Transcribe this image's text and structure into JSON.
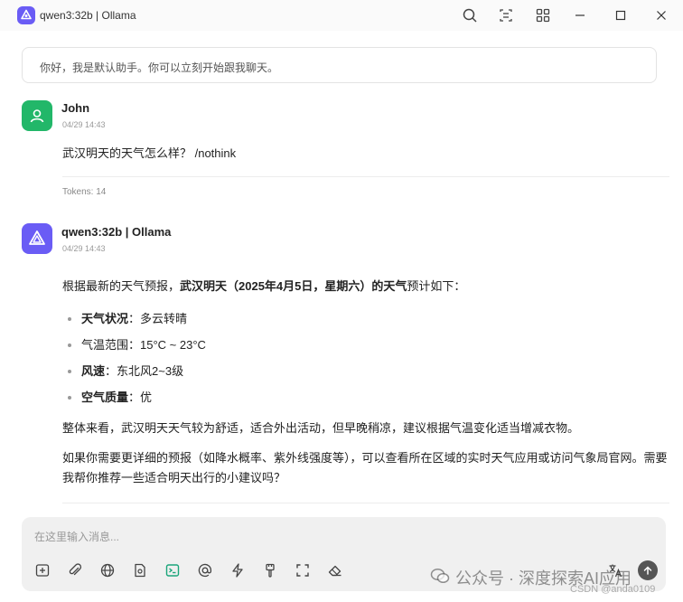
{
  "window": {
    "title": "qwen3:32b | Ollama"
  },
  "system_banner": {
    "text": "你好，我是默认助手。你可以立刻开始跟我聊天。"
  },
  "user_message": {
    "sender": "John",
    "time": "04/29 14:43",
    "text": "武汉明天的天气怎么样？ /nothink",
    "tokens": "Tokens: 14"
  },
  "bot_message": {
    "sender": "qwen3:32b | Ollama",
    "time": "04/29 14:43",
    "intro_prefix": "根据最新的天气预报，",
    "intro_bold": "武汉明天（2025年4月5日，星期六）的天气",
    "intro_suffix": "预计如下：",
    "items": [
      {
        "label": "天气状况",
        "value": "：多云转晴",
        "bold": true
      },
      {
        "label": "气温范围",
        "value": "：15°C ~ 23°C",
        "bold": false
      },
      {
        "label": "风速",
        "value": "：东北风2~3级",
        "bold": true
      },
      {
        "label": "空气质量",
        "value": "：优",
        "bold": true
      }
    ],
    "paragraph1": "整体来看，武汉明天天气较为舒适，适合外出活动，但早晚稍凉，建议根据气温变化适当增减衣物。",
    "paragraph2": "如果你需要更详细的预报（如降水概率、紫外线强度等），可以查看所在区域的实时天气应用或访问气象局官网。需要我帮你推荐一些适合明天出行的小建议吗？"
  },
  "composer": {
    "placeholder": "在这里输入消息..."
  },
  "watermark": {
    "text": "公众号 · 深度探索AI应用",
    "sub": "CSDN @anda0109"
  },
  "colors": {
    "user_avatar": "#22b769",
    "bot_avatar": "#6a5cf5",
    "composer_bg": "#f0f0f0",
    "active_tool": "#1aa57a"
  },
  "toolbar_icons": [
    "new-topic-icon",
    "attachment-icon",
    "web-search-icon",
    "knowledge-base-icon",
    "terminal-icon",
    "mention-icon",
    "quick-action-icon",
    "brush-icon",
    "fullscreen-icon",
    "clear-icon",
    "translate-icon"
  ]
}
